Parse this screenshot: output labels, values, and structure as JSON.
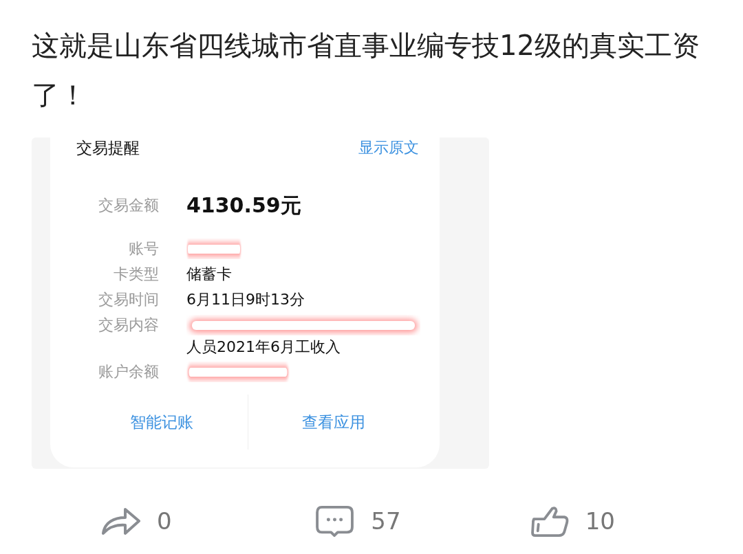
{
  "post": {
    "text": "这就是山东省四线城市省直事业编专技12级的真实工资了！"
  },
  "notification": {
    "title": "交易提醒",
    "show_original": "显示原文",
    "rows": [
      {
        "kind": "amount",
        "label": "交易金额",
        "value": "4130.59元"
      },
      {
        "kind": "redacted",
        "label": "账号"
      },
      {
        "kind": "text",
        "label": "卡类型",
        "value": "储蓄卡"
      },
      {
        "kind": "text",
        "label": "交易时间",
        "value": "6月11日9时13分"
      },
      {
        "kind": "redacted_text",
        "label": "交易内容",
        "value": "人员2021年6月工收入"
      },
      {
        "kind": "redacted",
        "label": "账户余额"
      }
    ],
    "actions": [
      "智能记账",
      "查看应用"
    ]
  },
  "stats": {
    "shares": "0",
    "comments": "57",
    "likes": "10"
  }
}
